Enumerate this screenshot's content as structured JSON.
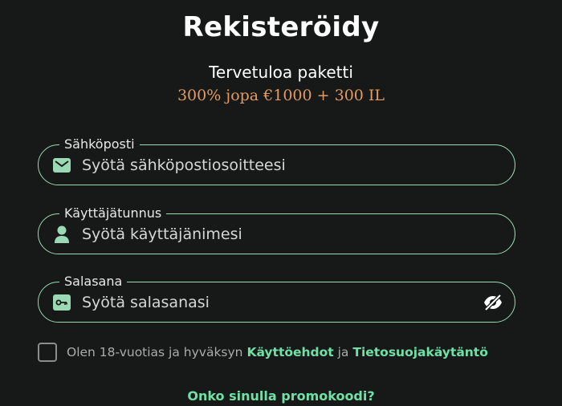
{
  "page": {
    "title": "Rekisteröidy",
    "welcome_label": "Tervetuloa paketti",
    "bonus_text": "300% jopa €1000 + 300 IL"
  },
  "form": {
    "email": {
      "label": "Sähköposti",
      "placeholder": "Syötä sähköpostiosoitteesi",
      "icon": "mail-icon"
    },
    "username": {
      "label": "Käyttäjätunnus",
      "placeholder": "Syötä käyttäjänimesi",
      "icon": "user-icon"
    },
    "password": {
      "label": "Salasana",
      "placeholder": "Syötä salasanasi",
      "icon": "key-icon",
      "toggle_icon": "eye-slash-icon"
    }
  },
  "consent": {
    "checked": false,
    "prefix": "Olen 18-vuotias ja hyväksyn ",
    "terms_link": "Käyttöehdot",
    "conjunction": " ja ",
    "privacy_link": "Tietosuojakäytäntö"
  },
  "promo": {
    "link_label": "Onko sinulla promokoodi?"
  },
  "colors": {
    "background": "#171918",
    "accent": "#6fe0a6",
    "border": "#9ad9b4",
    "bonus": "#e39a63"
  }
}
